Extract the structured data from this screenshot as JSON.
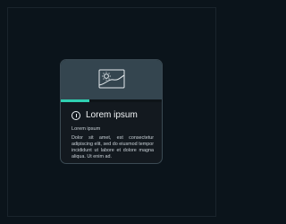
{
  "card": {
    "media_icon": "image-placeholder-icon",
    "progress": 0.28,
    "accent_color": "#2fd0b1",
    "header_icon": "info-icon",
    "title": "Lorem ipsum",
    "subtitle": "Lorem ipsum",
    "body": "Dolor sit amet, est consectetur adipiscing elit, sed do eiusmod tempor incididunt ut labore et dolore magna aliqua. Ut enim ad."
  }
}
